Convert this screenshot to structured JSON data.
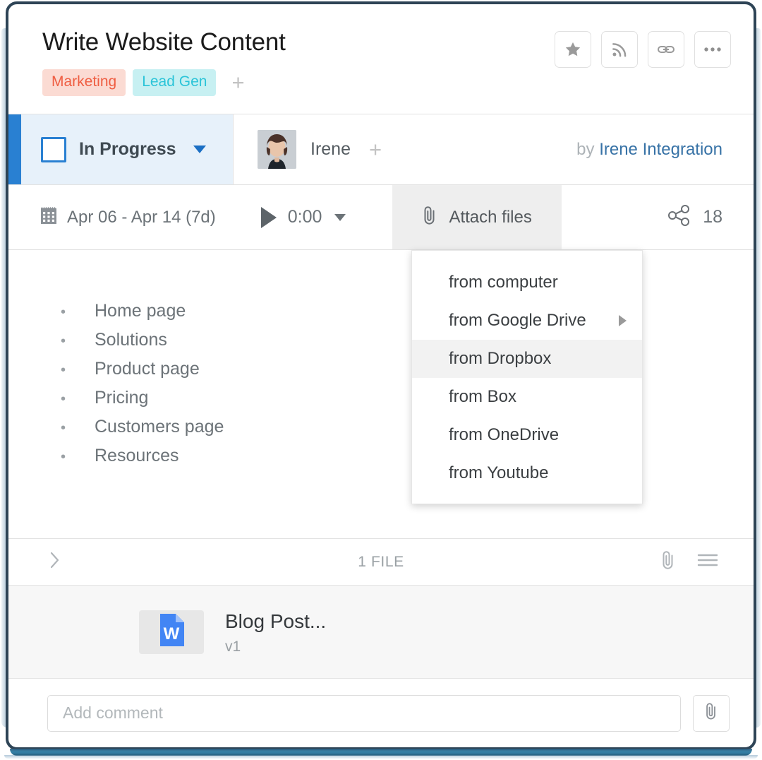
{
  "header": {
    "title": "Write Website Content",
    "tags": [
      {
        "label": "Marketing",
        "bg": "#fbdbd3",
        "fg": "#ef5e42"
      },
      {
        "label": "Lead Gen",
        "bg": "#c7f0f2",
        "fg": "#2bc4d8"
      }
    ],
    "add_tag_label": "+",
    "actions": [
      {
        "name": "star-icon",
        "title": "Star"
      },
      {
        "name": "rss-icon",
        "title": "Follow"
      },
      {
        "name": "link-icon",
        "title": "Copy link"
      },
      {
        "name": "ellipsis-icon",
        "title": "More"
      }
    ]
  },
  "status": {
    "label": "In Progress",
    "accent": "#2980d2",
    "background": "#e7f1fa",
    "assignee_name": "Irene",
    "add_assignee_label": "+",
    "author_prefix": "by",
    "author_name": "Irene Integration"
  },
  "toolbar": {
    "date_range": "Apr 06 - Apr 14 (7d)",
    "timer": "0:00",
    "attach_label": "Attach files",
    "share_count": "18"
  },
  "description": {
    "bullet_char": "•",
    "items": [
      "Home page",
      "Solutions",
      "Product page",
      "Pricing",
      "Customers page",
      "Resources"
    ]
  },
  "attach_menu": {
    "items": [
      {
        "label": "from computer",
        "active": false,
        "submenu": false
      },
      {
        "label": "from Google Drive",
        "active": false,
        "submenu": true
      },
      {
        "label": "from Dropbox",
        "active": true,
        "submenu": false
      },
      {
        "label": "from Box",
        "active": false,
        "submenu": false
      },
      {
        "label": "from OneDrive",
        "active": false,
        "submenu": false
      },
      {
        "label": "from Youtube",
        "active": false,
        "submenu": false
      }
    ]
  },
  "files": {
    "count_label": "1 FILE",
    "items": [
      {
        "name": "Blog Post...",
        "version": "v1",
        "icon": "word-doc-icon"
      }
    ]
  },
  "comment": {
    "placeholder": "Add comment",
    "value": ""
  }
}
